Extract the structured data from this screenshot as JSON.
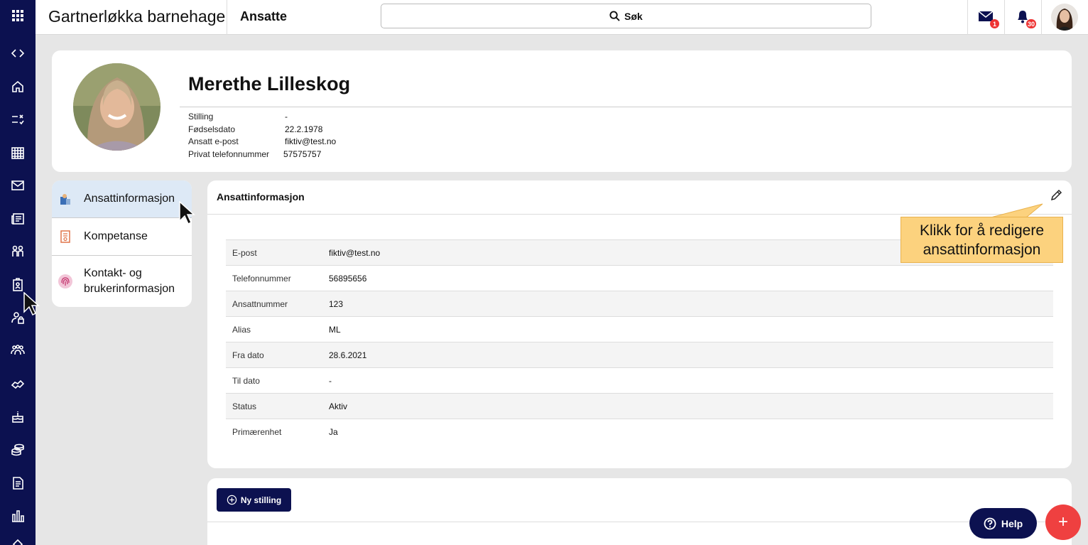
{
  "colors": {
    "nav_bg": "#0c1150",
    "accent_red": "#ef4040",
    "tooltip_bg": "#fcd27e",
    "active_menu": "#dde9f6"
  },
  "sidenav": {
    "icons": [
      "apps-grid-icon",
      "collapse-toggle-icon",
      "home-icon",
      "checklist-icon",
      "calendar-icon",
      "mail-icon",
      "news-icon",
      "children-icon",
      "employee-badge-icon",
      "user-lock-icon",
      "groups-icon",
      "handshake-icon",
      "cake-icon",
      "coins-icon",
      "document-icon",
      "bar-chart-icon"
    ]
  },
  "topbar": {
    "org_name": "Gartnerløkka barnehage",
    "page_title": "Ansatte",
    "search_label": "Søk",
    "mail_badge": "1",
    "notification_badge": "30"
  },
  "profile": {
    "name": "Merethe Lilleskog",
    "fields": [
      {
        "label": "Stilling",
        "value": "-"
      },
      {
        "label": "Fødselsdato",
        "value": "22.2.1978"
      },
      {
        "label": "Ansatt e-post",
        "value": "fiktiv@test.no"
      },
      {
        "label": "Privat telefonnummer",
        "value": "57575757"
      }
    ]
  },
  "menu": {
    "items": [
      {
        "label": "Ansattinformasjon",
        "icon": "employee-info-icon"
      },
      {
        "label": "Kompetanse",
        "icon": "certificate-icon"
      },
      {
        "label": "Kontakt- og brukerinformasjon",
        "icon": "fingerprint-icon"
      }
    ]
  },
  "info": {
    "title": "Ansattinformasjon",
    "rows": [
      {
        "label": "E-post",
        "value": "fiktiv@test.no"
      },
      {
        "label": "Telefonnummer",
        "value": "56895656"
      },
      {
        "label": "Ansattnummer",
        "value": "123"
      },
      {
        "label": "Alias",
        "value": "ML"
      },
      {
        "label": "Fra dato",
        "value": "28.6.2021"
      },
      {
        "label": "Til dato",
        "value": "-"
      },
      {
        "label": "Status",
        "value": "Aktiv"
      },
      {
        "label": "Primærenhet",
        "value": "Ja"
      }
    ]
  },
  "tooltip": {
    "line1": "Klikk for å redigere",
    "line2": "ansattinformasjon"
  },
  "stilling": {
    "button_label": "Ny stilling"
  },
  "help": {
    "label": "Help"
  },
  "fab": {
    "label": "+"
  }
}
